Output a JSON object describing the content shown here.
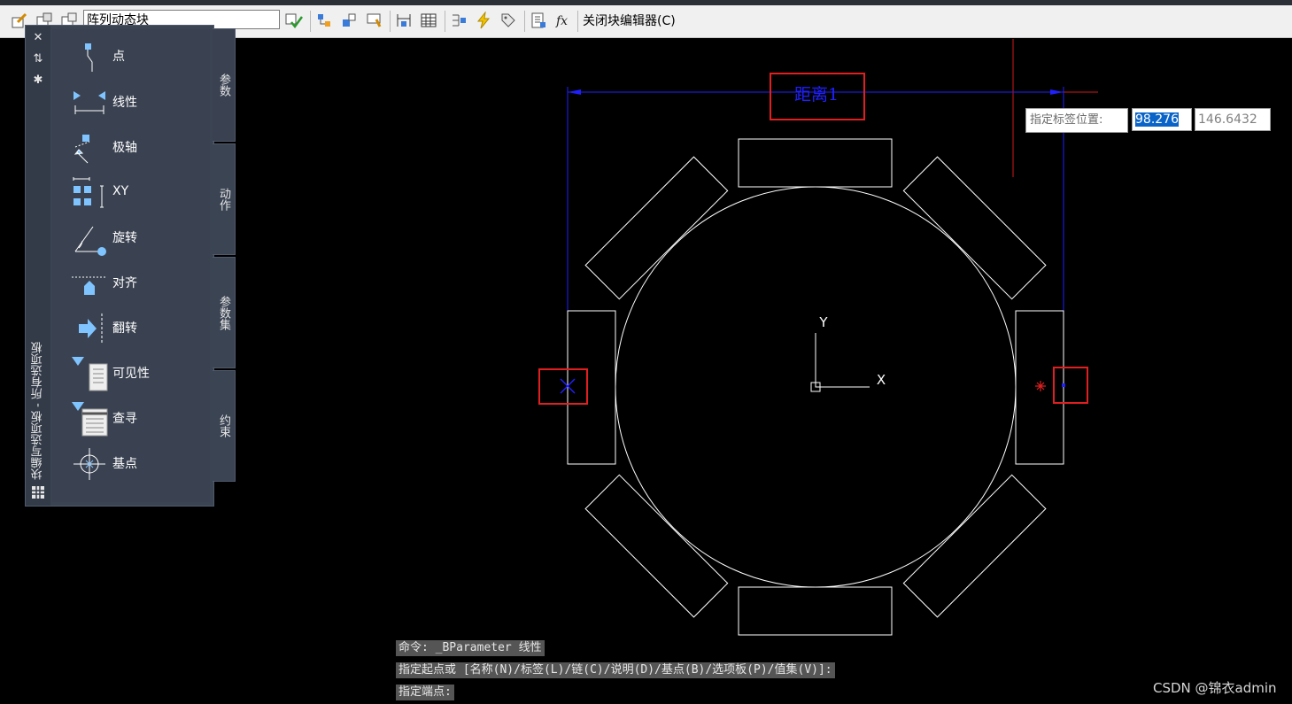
{
  "toolbar": {
    "block_name": "阵列动态块",
    "close_editor_label": "关闭块编辑器(C)",
    "icons": [
      "edit-block-icon",
      "save-block-icon",
      "save-as-icon",
      "test-block-icon",
      "parameter-manager-icon",
      "authoring-palette-icon",
      "attribute-icon",
      "define-icon",
      "table-icon",
      "visibility-icon",
      "lightning-icon",
      "tag-icon",
      "properties-icon",
      "fx-icon"
    ]
  },
  "palette": {
    "title": "块编写选项板 - 所有选项板",
    "tools": [
      {
        "label": "点"
      },
      {
        "label": "线性"
      },
      {
        "label": "极轴"
      },
      {
        "label": "XY"
      },
      {
        "label": "旋转"
      },
      {
        "label": "对齐"
      },
      {
        "label": "翻转"
      },
      {
        "label": "可见性"
      },
      {
        "label": "查寻"
      },
      {
        "label": "基点"
      }
    ],
    "tabs": [
      "参数",
      "动作",
      "参数集",
      "约束"
    ]
  },
  "drawing": {
    "distance_label": "距离1",
    "ucs_y": "Y",
    "ucs_x": "X"
  },
  "dynamic_input": {
    "prompt": "指定标签位置:",
    "value1": "98.276",
    "value2": "146.6432"
  },
  "command_history": [
    "命令: _BParameter 线性",
    "指定起点或 [名称(N)/标签(L)/链(C)/说明(D)/基点(B)/选项板(P)/值集(V)]:",
    "指定端点:"
  ],
  "watermark": "CSDN @锦衣admin",
  "colors": {
    "background": "#000000",
    "parameter_blue": "#2020ff",
    "highlight_red": "#e02020",
    "geometry": "#ffffff"
  }
}
